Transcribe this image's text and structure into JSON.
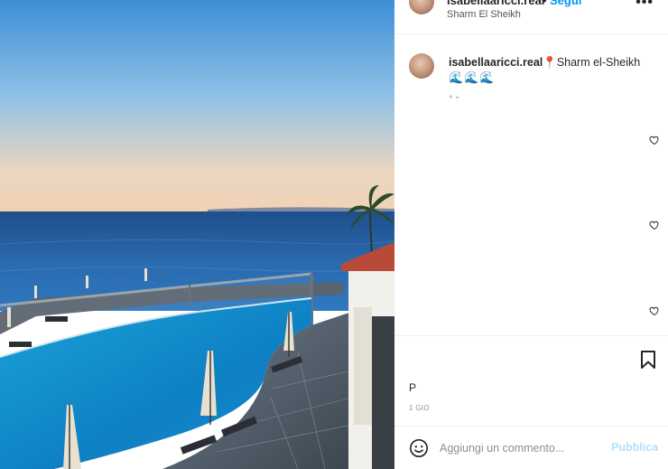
{
  "post": {
    "username": "isabellaaricci.real",
    "follow_label": "Segui",
    "location": "Sharm El Sheikh",
    "more_label": "•••"
  },
  "caption": {
    "username": "isabellaaricci.real",
    "text": "📍Sharm el-Sheikh",
    "emojis": "🌊🌊🌊",
    "time": "1 s"
  },
  "actions": {
    "likes_text": "P",
    "date": "1 GIO"
  },
  "comment": {
    "placeholder": "Aggiungi un commento...",
    "publish_label": "Pubblica"
  },
  "colors": {
    "link": "#0095f6",
    "publish_disabled": "#b2dffc",
    "secondary_text": "#8e8e8e"
  },
  "icons": [
    "more-icon",
    "heart-icon",
    "bookmark-icon",
    "smiley-icon",
    "location-pin-icon"
  ]
}
